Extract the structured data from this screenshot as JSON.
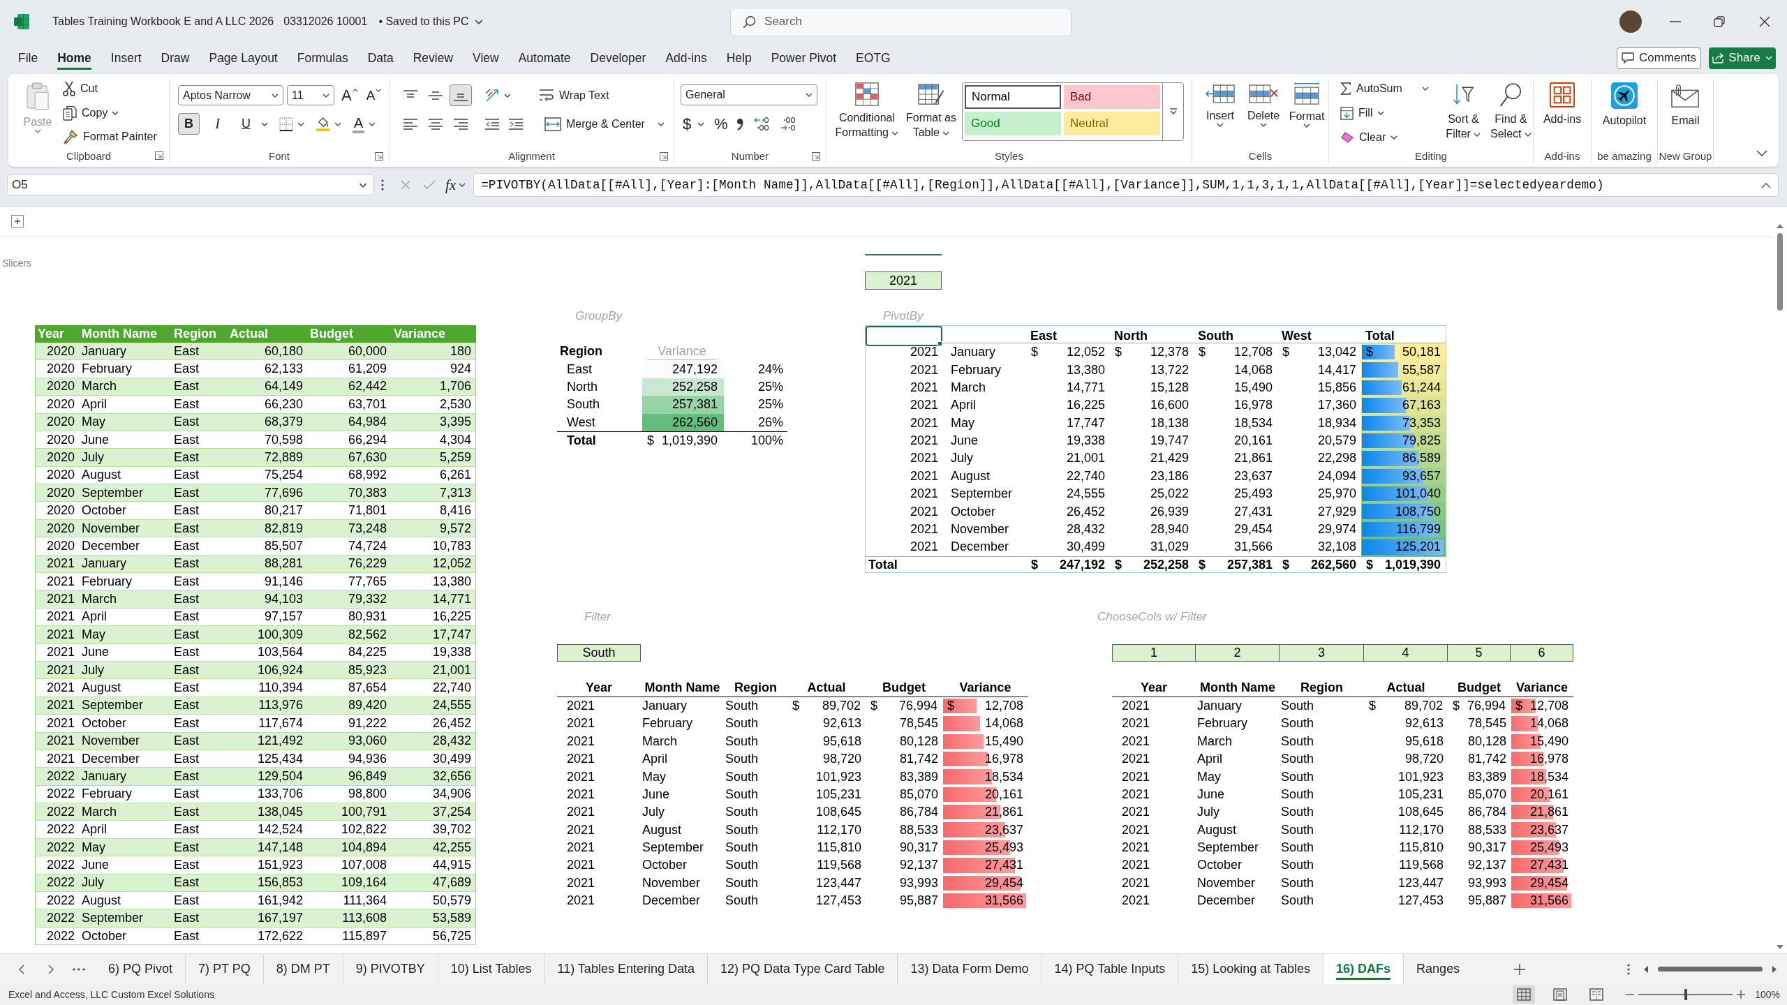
{
  "title_bar": {
    "filename": "Tables Training Workbook E and A LLC 2026",
    "file_id": "03312026 10001",
    "save_status": "• Saved to this PC",
    "search": {
      "placeholder": "Search"
    }
  },
  "menu_tabs": [
    {
      "label": "File",
      "selected": false
    },
    {
      "label": "Home",
      "selected": true
    },
    {
      "label": "Insert",
      "selected": false
    },
    {
      "label": "Draw",
      "selected": false
    },
    {
      "label": "Page Layout",
      "selected": false
    },
    {
      "label": "Formulas",
      "selected": false
    },
    {
      "label": "Data",
      "selected": false
    },
    {
      "label": "Review",
      "selected": false
    },
    {
      "label": "View",
      "selected": false
    },
    {
      "label": "Automate",
      "selected": false
    },
    {
      "label": "Developer",
      "selected": false
    },
    {
      "label": "Add-ins",
      "selected": false
    },
    {
      "label": "Help",
      "selected": false
    },
    {
      "label": "Power Pivot",
      "selected": false
    },
    {
      "label": "EOTG",
      "selected": false
    }
  ],
  "header_buttons": {
    "comments": "Comments",
    "share": "Share"
  },
  "ribbon": {
    "clipboard": {
      "label": "Clipboard",
      "paste": {
        "label": "Paste",
        "disabled": true
      },
      "cut": "Cut",
      "copy": "Copy",
      "format_painter": "Format Painter"
    },
    "font": {
      "label": "Font",
      "font_name": "Aptos Narrow",
      "font_size": "11",
      "grow": "A",
      "shrink": "A",
      "bold": {
        "label": "B",
        "on": true
      },
      "italic": {
        "label": "I",
        "on": false
      },
      "underline": {
        "label": "U",
        "on": false
      },
      "font_color": "A"
    },
    "alignment": {
      "label": "Alignment",
      "vertical": [
        {
          "kind": "top",
          "on": false
        },
        {
          "kind": "middle",
          "on": false
        },
        {
          "kind": "bottom",
          "on": true
        }
      ],
      "wrap_text": "Wrap Text",
      "merge_center": "Merge & Center"
    },
    "number": {
      "label": "Number",
      "format": "General",
      "currency": "$",
      "percent": "%"
    },
    "styles": {
      "label": "Styles",
      "conditional_formatting": [
        "Conditional",
        "Formatting"
      ],
      "format_as_table": [
        "Format as",
        "Table"
      ],
      "gallery": [
        {
          "label": "Normal",
          "color": "#ffffff",
          "selected": true
        },
        {
          "label": "Bad",
          "color": "#ffc7ce",
          "selected": false
        },
        {
          "label": "Good",
          "color": "#c6efce",
          "selected": false
        },
        {
          "label": "Neutral",
          "color": "#ffeb9c",
          "selected": false
        }
      ]
    },
    "cells": {
      "label": "Cells",
      "insert": "Insert",
      "delete": "Delete",
      "format": "Format"
    },
    "editing": {
      "label": "Editing",
      "autosum": "AutoSum",
      "fill": "Fill",
      "clear": "Clear",
      "sort_filter": [
        "Sort &",
        "Filter"
      ],
      "find_select": [
        "Find &",
        "Select"
      ]
    },
    "add_ins": {
      "label": "Add-ins",
      "button": "Add-ins"
    },
    "custom_groups": [
      {
        "kind": "autopilot",
        "label": "be amazing",
        "button": "Autopilot"
      },
      {
        "kind": "email",
        "label": "New Group",
        "button": "Email"
      }
    ]
  },
  "formula_bar": {
    "name_box": "O5",
    "function_button": "fx",
    "formula": "=PIVOTBY(AllData[[#All],[Year]:[Month Name]],AllData[[#All],[Region]],AllData[[#All],[Variance]],SUM,1,1,3,1,1,AllData[[#All],[Year]]=selectedyeardemo)"
  },
  "sheet": {
    "slicers_label": "Slicers",
    "year_input": "2021",
    "groupby": {
      "title": "GroupBy",
      "row_header": "Region",
      "value_header": "Variance",
      "rows": [
        {
          "region": "East",
          "value": "247,192",
          "color": "#fbfcfe",
          "share": "24%"
        },
        {
          "region": "North",
          "value": "252,258",
          "color": "#c8e8d2",
          "share": "25%"
        },
        {
          "region": "South",
          "value": "257,381",
          "color": "#96d3a7",
          "share": "25%"
        },
        {
          "region": "West",
          "value": "262,560",
          "color": "#63be7b",
          "share": "26%"
        }
      ],
      "total": {
        "label": "Total",
        "symbol": "$",
        "value": "1,019,390",
        "share": "100%"
      }
    },
    "pivotby": {
      "title": "PivotBy",
      "corner": {
        "selected": true
      },
      "columns": [
        "East",
        "North",
        "South",
        "West",
        "Total"
      ],
      "rows": [
        {
          "year": "2021",
          "month": "January",
          "cells": [
            {
              "symbol": "$",
              "value": "12,052"
            },
            {
              "symbol": "$",
              "value": "12,378"
            },
            {
              "symbol": "$",
              "value": "12,708"
            },
            {
              "symbol": "$",
              "value": "13,042"
            }
          ],
          "total": {
            "symbol": "$",
            "value": "50,181",
            "level": 0.401
          }
        },
        {
          "year": "2021",
          "month": "February",
          "cells": [
            "13,380",
            "13,722",
            "14,068",
            "14,417"
          ],
          "total": {
            "value": "55,587",
            "level": 0.444
          }
        },
        {
          "year": "2021",
          "month": "March",
          "cells": [
            "14,771",
            "15,128",
            "15,490",
            "15,856"
          ],
          "total": {
            "value": "61,244",
            "level": 0.489
          }
        },
        {
          "year": "2021",
          "month": "April",
          "cells": [
            "16,225",
            "16,600",
            "16,978",
            "17,360"
          ],
          "total": {
            "value": "67,163",
            "level": 0.536
          }
        },
        {
          "year": "2021",
          "month": "May",
          "cells": [
            "17,747",
            "18,138",
            "18,534",
            "18,934"
          ],
          "total": {
            "value": "73,353",
            "level": 0.586
          }
        },
        {
          "year": "2021",
          "month": "June",
          "cells": [
            "19,338",
            "19,747",
            "20,161",
            "20,579"
          ],
          "total": {
            "value": "79,825",
            "level": 0.638
          }
        },
        {
          "year": "2021",
          "month": "July",
          "cells": [
            "21,001",
            "21,429",
            "21,861",
            "22,298"
          ],
          "total": {
            "value": "86,589",
            "level": 0.692
          }
        },
        {
          "year": "2021",
          "month": "August",
          "cells": [
            "22,740",
            "23,186",
            "23,637",
            "24,094"
          ],
          "total": {
            "value": "93,657",
            "level": 0.748
          }
        },
        {
          "year": "2021",
          "month": "September",
          "cells": [
            "24,555",
            "25,022",
            "25,493",
            "25,970"
          ],
          "total": {
            "value": "101,040",
            "level": 0.807
          }
        },
        {
          "year": "2021",
          "month": "October",
          "cells": [
            "26,452",
            "26,939",
            "27,431",
            "27,929"
          ],
          "total": {
            "value": "108,750",
            "level": 0.869
          }
        },
        {
          "year": "2021",
          "month": "November",
          "cells": [
            "28,432",
            "28,940",
            "29,454",
            "29,974"
          ],
          "total": {
            "value": "116,799",
            "level": 0.933
          }
        },
        {
          "year": "2021",
          "month": "December",
          "cells": [
            "30,499",
            "31,029",
            "31,566",
            "32,108"
          ],
          "total": {
            "value": "125,201",
            "level": 1
          }
        }
      ],
      "total": {
        "label": "Total",
        "cells": [
          {
            "symbol": "$",
            "value": "247,192"
          },
          {
            "symbol": "$",
            "value": "252,258"
          },
          {
            "symbol": "$",
            "value": "257,381"
          },
          {
            "symbol": "$",
            "value": "262,560"
          },
          {
            "symbol": "$",
            "value": "1,019,390"
          }
        ]
      }
    },
    "source_table": {
      "banded_rows": true,
      "columns": [
        {
          "label": "Year",
          "kind": "number"
        },
        {
          "label": "Month Name",
          "kind": "text"
        },
        {
          "label": "Region",
          "kind": "text"
        },
        {
          "label": "Actual",
          "kind": "number"
        },
        {
          "label": "Budget",
          "kind": "number"
        },
        {
          "label": "Variance",
          "kind": "number"
        }
      ],
      "rows": [
        [
          "2020",
          "January",
          "East",
          "60,180",
          "60,000",
          "180"
        ],
        [
          "2020",
          "February",
          "East",
          "62,133",
          "61,209",
          "924"
        ],
        [
          "2020",
          "March",
          "East",
          "64,149",
          "62,442",
          "1,706"
        ],
        [
          "2020",
          "April",
          "East",
          "66,230",
          "63,701",
          "2,530"
        ],
        [
          "2020",
          "May",
          "East",
          "68,379",
          "64,984",
          "3,395"
        ],
        [
          "2020",
          "June",
          "East",
          "70,598",
          "66,294",
          "4,304"
        ],
        [
          "2020",
          "July",
          "East",
          "72,889",
          "67,630",
          "5,259"
        ],
        [
          "2020",
          "August",
          "East",
          "75,254",
          "68,992",
          "6,261"
        ],
        [
          "2020",
          "September",
          "East",
          "77,696",
          "70,383",
          "7,313"
        ],
        [
          "2020",
          "October",
          "East",
          "80,217",
          "71,801",
          "8,416"
        ],
        [
          "2020",
          "November",
          "East",
          "82,819",
          "73,248",
          "9,572"
        ],
        [
          "2020",
          "December",
          "East",
          "85,507",
          "74,724",
          "10,783"
        ],
        [
          "2021",
          "January",
          "East",
          "88,281",
          "76,229",
          "12,052"
        ],
        [
          "2021",
          "February",
          "East",
          "91,146",
          "77,765",
          "13,380"
        ],
        [
          "2021",
          "March",
          "East",
          "94,103",
          "79,332",
          "14,771"
        ],
        [
          "2021",
          "April",
          "East",
          "97,157",
          "80,931",
          "16,225"
        ],
        [
          "2021",
          "May",
          "East",
          "100,309",
          "82,562",
          "17,747"
        ],
        [
          "2021",
          "June",
          "East",
          "103,564",
          "84,225",
          "19,338"
        ],
        [
          "2021",
          "July",
          "East",
          "106,924",
          "85,923",
          "21,001"
        ],
        [
          "2021",
          "August",
          "East",
          "110,394",
          "87,654",
          "22,740"
        ],
        [
          "2021",
          "September",
          "East",
          "113,976",
          "89,420",
          "24,555"
        ],
        [
          "2021",
          "October",
          "East",
          "117,674",
          "91,222",
          "26,452"
        ],
        [
          "2021",
          "November",
          "East",
          "121,492",
          "93,060",
          "28,432"
        ],
        [
          "2021",
          "December",
          "East",
          "125,434",
          "94,936",
          "30,499"
        ],
        [
          "2022",
          "January",
          "East",
          "129,504",
          "96,849",
          "32,656"
        ],
        [
          "2022",
          "February",
          "East",
          "133,706",
          "98,800",
          "34,906"
        ],
        [
          "2022",
          "March",
          "East",
          "138,045",
          "100,791",
          "37,254"
        ],
        [
          "2022",
          "April",
          "East",
          "142,524",
          "102,822",
          "39,702"
        ],
        [
          "2022",
          "May",
          "East",
          "147,148",
          "104,894",
          "42,255"
        ],
        [
          "2022",
          "June",
          "East",
          "151,923",
          "107,008",
          "44,915"
        ],
        [
          "2022",
          "July",
          "East",
          "156,853",
          "109,164",
          "47,689"
        ],
        [
          "2022",
          "August",
          "East",
          "161,942",
          "111,364",
          "50,579"
        ],
        [
          "2022",
          "September",
          "East",
          "167,197",
          "113,608",
          "53,589"
        ],
        [
          "2022",
          "October",
          "East",
          "172,622",
          "115,897",
          "56,725"
        ]
      ]
    },
    "filter": {
      "title": "Filter",
      "criteria": "South",
      "columns": [
        {
          "label": "Year",
          "kind": "indent"
        },
        {
          "label": "Month Name",
          "kind": "text"
        },
        {
          "label": "Region",
          "kind": "text"
        },
        {
          "label": "Actual",
          "kind": "number"
        },
        {
          "label": "Budget",
          "kind": "number"
        },
        {
          "label": "Variance",
          "kind": "bar"
        }
      ],
      "rows": [
        [
          "2021",
          "January",
          "South",
          {
            "symbol": "$",
            "value": "89,702"
          },
          {
            "symbol": "$",
            "value": "76,994"
          },
          {
            "symbol": "$",
            "value": "12,708",
            "level": 0.403
          }
        ],
        [
          "2021",
          "February",
          "South",
          "92,613",
          "78,545",
          {
            "value": "14,068",
            "level": 0.446
          }
        ],
        [
          "2021",
          "March",
          "South",
          "95,618",
          "80,128",
          {
            "value": "15,490",
            "level": 0.491
          }
        ],
        [
          "2021",
          "April",
          "South",
          "98,720",
          "81,742",
          {
            "value": "16,978",
            "level": 0.538
          }
        ],
        [
          "2021",
          "May",
          "South",
          "101,923",
          "83,389",
          {
            "value": "18,534",
            "level": 0.587
          }
        ],
        [
          "2021",
          "June",
          "South",
          "105,231",
          "85,070",
          {
            "value": "20,161",
            "level": 0.639
          }
        ],
        [
          "2021",
          "July",
          "South",
          "108,645",
          "86,784",
          {
            "value": "21,861",
            "level": 0.693
          }
        ],
        [
          "2021",
          "August",
          "South",
          "112,170",
          "88,533",
          {
            "value": "23,637",
            "level": 0.749
          }
        ],
        [
          "2021",
          "September",
          "South",
          "115,810",
          "90,317",
          {
            "value": "25,493",
            "level": 0.808
          }
        ],
        [
          "2021",
          "October",
          "South",
          "119,568",
          "92,137",
          {
            "value": "27,431",
            "level": 0.869
          }
        ],
        [
          "2021",
          "November",
          "South",
          "123,447",
          "93,993",
          {
            "value": "29,454",
            "level": 0.933
          }
        ],
        [
          "2021",
          "December",
          "South",
          "127,453",
          "95,887",
          {
            "value": "31,566",
            "level": 1
          }
        ]
      ]
    },
    "choose_cols": {
      "title": "ChooseCols w/ Filter",
      "indices": [
        "1",
        "2",
        "3",
        "4",
        "5",
        "6"
      ],
      "columns": [
        {
          "label": "Year",
          "kind": "indent"
        },
        {
          "label": "Month Name",
          "kind": "text"
        },
        {
          "label": "Region",
          "kind": "text"
        },
        {
          "label": "Actual",
          "kind": "number"
        },
        {
          "label": "Budget",
          "kind": "number"
        },
        {
          "label": "Variance",
          "kind": "bar"
        }
      ],
      "rows": [
        [
          "2021",
          "January",
          "South",
          {
            "symbol": "$",
            "value": "89,702"
          },
          {
            "symbol": "$",
            "value": "76,994"
          },
          {
            "symbol": "$",
            "value": "12,708",
            "level": 0.403
          }
        ],
        [
          "2021",
          "February",
          "South",
          "92,613",
          "78,545",
          {
            "value": "14,068",
            "level": 0.446
          }
        ],
        [
          "2021",
          "March",
          "South",
          "95,618",
          "80,128",
          {
            "value": "15,490",
            "level": 0.491
          }
        ],
        [
          "2021",
          "April",
          "South",
          "98,720",
          "81,742",
          {
            "value": "16,978",
            "level": 0.538
          }
        ],
        [
          "2021",
          "May",
          "South",
          "101,923",
          "83,389",
          {
            "value": "18,534",
            "level": 0.587
          }
        ],
        [
          "2021",
          "June",
          "South",
          "105,231",
          "85,070",
          {
            "value": "20,161",
            "level": 0.639
          }
        ],
        [
          "2021",
          "July",
          "South",
          "108,645",
          "86,784",
          {
            "value": "21,861",
            "level": 0.693
          }
        ],
        [
          "2021",
          "August",
          "South",
          "112,170",
          "88,533",
          {
            "value": "23,637",
            "level": 0.749
          }
        ],
        [
          "2021",
          "September",
          "South",
          "115,810",
          "90,317",
          {
            "value": "25,493",
            "level": 0.808
          }
        ],
        [
          "2021",
          "October",
          "South",
          "119,568",
          "92,137",
          {
            "value": "27,431",
            "level": 0.869
          }
        ],
        [
          "2021",
          "November",
          "South",
          "123,447",
          "93,993",
          {
            "value": "29,454",
            "level": 0.933
          }
        ],
        [
          "2021",
          "December",
          "South",
          "127,453",
          "95,887",
          {
            "value": "31,566",
            "level": 1
          }
        ]
      ]
    }
  },
  "sheet_tabs": [
    {
      "label": "6) PQ Pivot",
      "selected": false
    },
    {
      "label": "7) PT PQ",
      "selected": false
    },
    {
      "label": "8) DM PT",
      "selected": false
    },
    {
      "label": "9) PIVOTBY",
      "selected": false
    },
    {
      "label": "10) List Tables",
      "selected": false
    },
    {
      "label": "11) Tables Entering Data",
      "selected": false
    },
    {
      "label": "12) PQ Data Type Card Table",
      "selected": false
    },
    {
      "label": "13) Data Form Demo",
      "selected": false
    },
    {
      "label": "14) PQ Table Inputs",
      "selected": false
    },
    {
      "label": "15) Looking at Tables",
      "selected": false
    },
    {
      "label": "16) DAFs",
      "selected": true
    },
    {
      "label": "Ranges",
      "selected": false
    }
  ],
  "status_bar": {
    "message": "Excel and Access, LLC Custom Excel Solutions",
    "views": [
      {
        "kind": "normal",
        "selected": true
      },
      {
        "kind": "page_layout",
        "selected": false
      },
      {
        "kind": "page_break",
        "selected": false
      }
    ],
    "zoom": {
      "level": 0.5,
      "label": "100%"
    }
  }
}
